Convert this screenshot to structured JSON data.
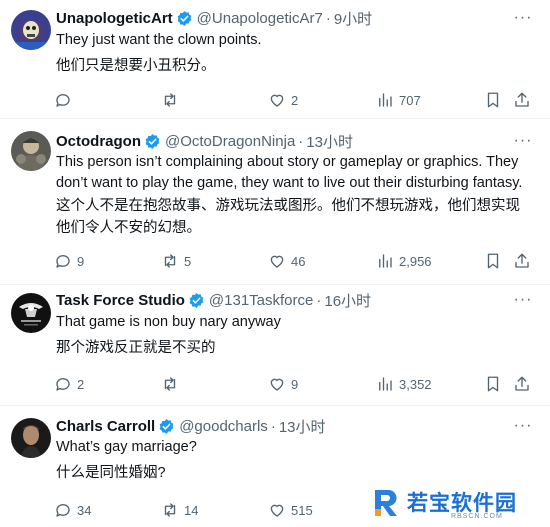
{
  "colors": {
    "text_primary": "#0f1419",
    "text_secondary": "#536471",
    "verified_blue": "#1d9bf0",
    "divider": "#eff3f4",
    "watermark_blue": "#1b6fd1"
  },
  "tweets": [
    {
      "name": "UnapologeticArt",
      "handle": "@UnapologeticAr7",
      "dot": "·",
      "time": "9小时",
      "text": "They just want the clown points.",
      "translation": "他们只是想要小丑积分。",
      "avatar_icon": "skeletor-avatar",
      "replies": "",
      "retweets": "",
      "likes": "2",
      "views": "707"
    },
    {
      "name": "Octodragon",
      "handle": "@OctoDragonNinja",
      "dot": "·",
      "time": "13小时",
      "text": "This person isn’t complaining about story or gameplay or graphics. They don’t want to play the game, they want to live out their disturbing fantasy.",
      "translation": "这个人不是在抱怨故事、游戏玩法或图形。他们不想玩游戏，他们想实现他们令人不安的幻想。",
      "avatar_icon": "armored-character-avatar",
      "replies": "9",
      "retweets": "5",
      "likes": "46",
      "views": "2,956"
    },
    {
      "name": "Task Force Studio",
      "handle": "@131Taskforce",
      "dot": "·",
      "time": "16小时",
      "text": "That game is non buy nary anyway",
      "translation": "那个游戏反正就是不买的",
      "avatar_icon": "eagle-logo-avatar",
      "replies": "2",
      "retweets": "",
      "likes": "9",
      "views": "3,352"
    },
    {
      "name": "Charls Carroll",
      "handle": "@goodcharls",
      "dot": "·",
      "time": "13小时",
      "text": "What’s gay marriage?",
      "translation": "什么是同性婚姻?",
      "avatar_icon": "portrait-avatar",
      "replies": "34",
      "retweets": "14",
      "likes": "515",
      "views": ""
    }
  ],
  "more_label": "···",
  "watermark": {
    "text": "若宝软件园",
    "url": "RBSCN.COM"
  }
}
